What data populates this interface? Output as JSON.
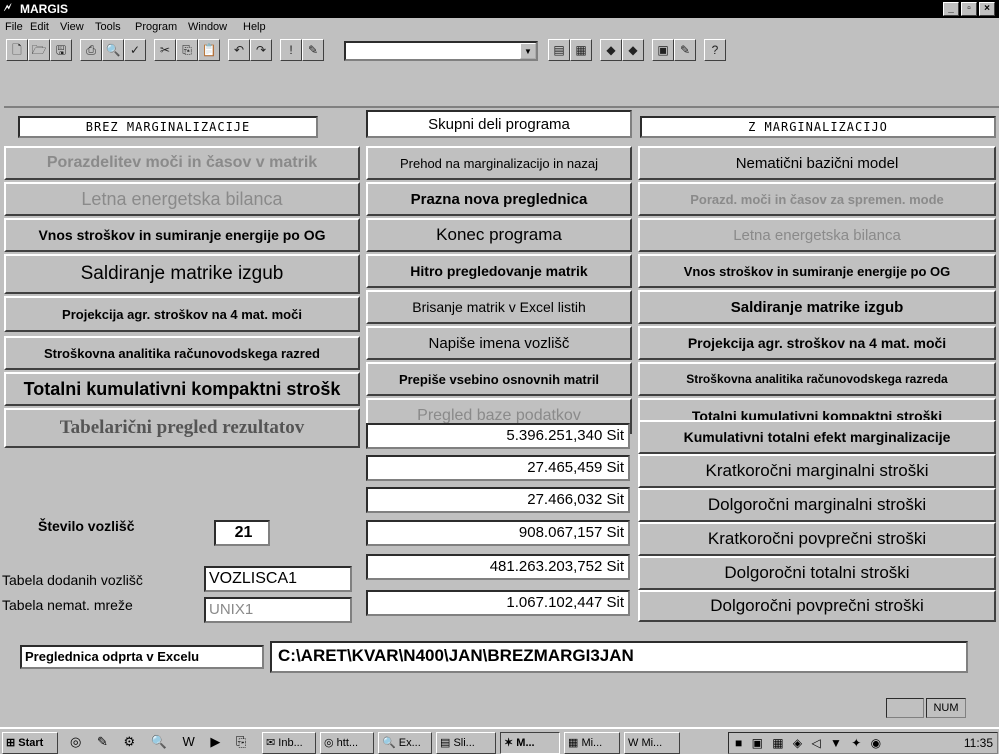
{
  "window": {
    "title": "MARGIS",
    "logo": "🗲",
    "min": "_",
    "max": "▫",
    "close": "×"
  },
  "menu": [
    "File",
    "Edit",
    "View",
    "Tools",
    "Program",
    "Window",
    "Help"
  ],
  "toolbar": {
    "icons_left": [
      "🗋",
      "🗁",
      "🖫",
      "⎙",
      "🔍",
      "✓",
      "✂",
      "⎘",
      "📋",
      "↶",
      "↷",
      "!",
      "✎"
    ],
    "icons_right": [
      "▤",
      "▦",
      "◆",
      "◆",
      "▣",
      "✎",
      "?"
    ],
    "combo_value": ""
  },
  "headers": {
    "left": "BREZ MARGINALIZACIJE",
    "middle": "Skupni deli programa",
    "right": "Z MARGINALIZACIJO"
  },
  "left_buttons": [
    "Porazdelitev moči in časov v matrik",
    "Letna energetska bilanca",
    "Vnos stroškov in sumiranje energije po OG",
    "Saldiranje matrike izgub",
    "Projekcija agr. stroškov na 4 mat. moči",
    "Stroškovna analitika računovodskega razred",
    "Totalni kumulativni kompaktni strošk",
    "Tabelarični  pregled rezultatov"
  ],
  "middle_buttons": [
    "Prehod na marginalizacijo in nazaj",
    "Prazna nova preglednica",
    "Konec programa",
    "Hitro pregledovanje matrik",
    "Brisanje matrik v Excel listih",
    "Napiše imena vozlišč",
    "Prepiše vsebino osnovnih matril",
    "Pregled baze podatkov"
  ],
  "right_buttons": [
    "Nematični bazični model",
    "Porazd. moči in časov za spremen. mode",
    "Letna energetska bilanca",
    "Vnos stroškov in sumiranje energije po OG",
    "Saldiranje matrike izgub",
    "Projekcija agr. stroškov na 4 mat. moči",
    "Stroškovna analitika računovodskega razreda",
    "Totalni kumulativni kompaktni stroški",
    "Kumulativni totalni efekt marginalizacije",
    "Kratkoročni marginalni stroški",
    "Dolgoročni marginalni stroški",
    "Kratkoročni povprečni stroški",
    "Dolgoročni totalni stroški",
    "Dolgoročni povprečni stroški"
  ],
  "values": [
    "5.396.251,340 Sit",
    "27.465,459 Sit",
    "27.466,032 Sit",
    "908.067,157 Sit",
    "481.263.203,752 Sit",
    "1.067.102,447 Sit"
  ],
  "nodes": {
    "label": "Število vozlišč",
    "value": "21"
  },
  "added_nodes": {
    "label": "Tabela dodanih vozlišč",
    "value": "VOZLISCA1"
  },
  "nonmat_network": {
    "label": "Tabela nemat. mreže",
    "value": "UNIX1"
  },
  "excel": {
    "label": "Preglednica odprta v Excelu",
    "path": "C:\\ARET\\KVAR\\N400\\JAN\\BREZMARGI3JAN"
  },
  "status": {
    "num": "NUM"
  },
  "taskbar": {
    "start": "Start",
    "tasks": [
      "Inb...",
      "htt...",
      "Ex...",
      "Sli...",
      "M...",
      "Mi...",
      "Mi..."
    ],
    "clock": "11:35"
  }
}
